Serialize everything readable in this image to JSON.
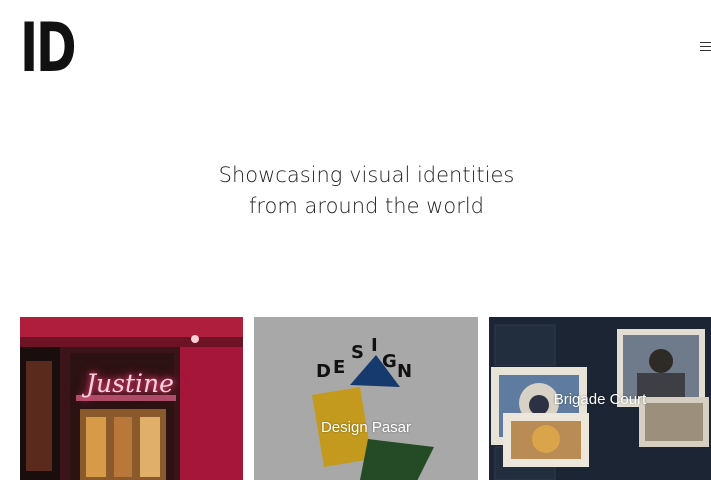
{
  "brand": {
    "logo_text": "ID"
  },
  "header": {
    "menu_icon": "hamburger-menu-icon"
  },
  "hero": {
    "line1": "Showcasing visual identities",
    "line2": "from around the world"
  },
  "cards": [
    {
      "label": "",
      "sign_text": "Justine"
    },
    {
      "label": "Design Pasar",
      "letters": [
        "D",
        "E",
        "S",
        "I",
        "G",
        "N"
      ]
    },
    {
      "label": "Brigade Court"
    }
  ]
}
